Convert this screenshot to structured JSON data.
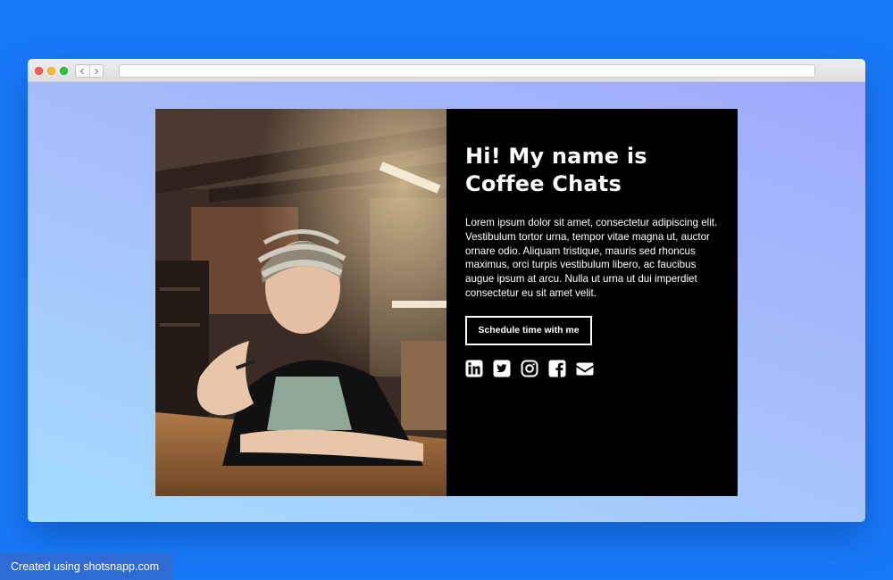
{
  "browser": {
    "buttons": [
      "close",
      "minimize",
      "maximize"
    ],
    "nav": {
      "back_icon": "chevron-left-icon",
      "forward_icon": "chevron-right-icon"
    },
    "address": ""
  },
  "profile": {
    "heading": "Hi! My name is Coffee Chats",
    "bio": "Lorem ipsum dolor sit amet, consectetur adipiscing elit. Vestibulum tortor urna, tempor vitae magna ut, auctor ornare odio. Aliquam tristique, mauris sed rhoncus maximus, orci turpis vestibulum libero, ac faucibus augue ipsum at arcu. Nulla ut urna ut dui imperdiet consectetur eu sit amet velit.",
    "cta_label": "Schedule time with me",
    "social_icons": [
      "linkedin-icon",
      "twitter-icon",
      "instagram-icon",
      "facebook-icon",
      "email-icon"
    ]
  },
  "footer": {
    "badge_text": "Created using shotsnapp.com"
  },
  "colors": {
    "page_background": "#1879f7",
    "panel_background": "#000000",
    "text": "#ffffff"
  }
}
